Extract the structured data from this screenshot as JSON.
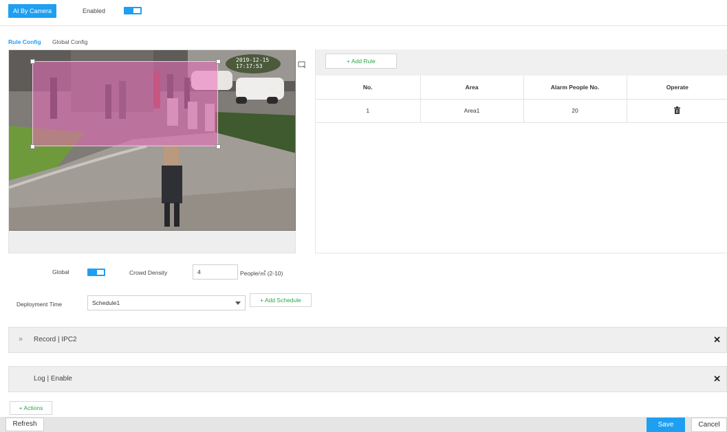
{
  "header": {
    "mode_button": "AI By Camera",
    "enabled_label": "Enabled",
    "enabled_on": true
  },
  "tabs": [
    {
      "label": "Rule Config",
      "active": true
    },
    {
      "label": "Global Config",
      "active": false
    }
  ],
  "preview": {
    "osd_timestamp": "2019-12-15 17:17:53"
  },
  "rules": {
    "add_rule_label": "+ Add Rule",
    "columns": [
      "No.",
      "Area",
      "Alarm People No.",
      "Operate"
    ],
    "rows": [
      {
        "no": "1",
        "area": "Area1",
        "alarm_people": "20",
        "operate_icon": "trash-icon"
      }
    ]
  },
  "global_config": {
    "global_label": "Global",
    "global_on": true,
    "crowd_density_label": "Crowd Density",
    "crowd_density_value": "4",
    "crowd_density_unit": "People/㎡ (2-10)",
    "deployment_time_label": "Deployment Time",
    "schedule_value": "Schedule1",
    "add_schedule_label": "+ Add Schedule"
  },
  "actions": {
    "record_title": "Record | IPC2",
    "log_title": "Log | Enable",
    "add_actions_label": "+ Actions",
    "expand_glyph": "»",
    "close_glyph": "✕"
  },
  "footer": {
    "refresh": "Refresh",
    "save": "Save",
    "cancel": "Cancel"
  },
  "colors": {
    "accent": "#1e9ff2",
    "add_green": "#2aa846",
    "rule_area": "#ec6ebe"
  }
}
